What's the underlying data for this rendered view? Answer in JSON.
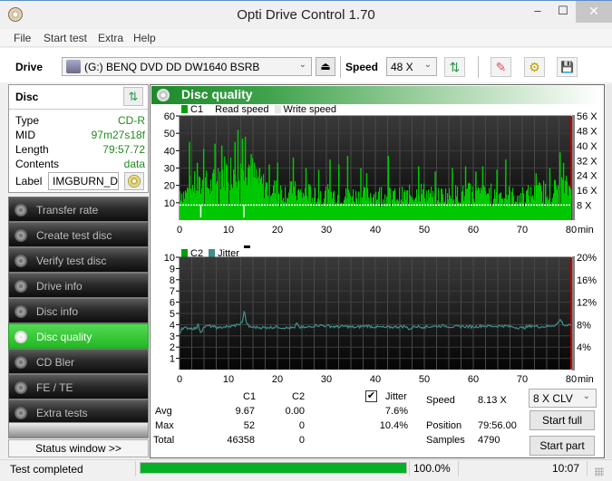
{
  "window": {
    "title": "Opti Drive Control 1.70",
    "min": "‒",
    "max": "☐",
    "close": "✕"
  },
  "menu": [
    "File",
    "Start test",
    "Extra",
    "Help"
  ],
  "toolbar": {
    "drive_label": "Drive",
    "drive_value": "(G:)  BENQ DVD DD DW1640 BSRB",
    "eject": "⏏",
    "speed_label": "Speed",
    "speed_value": "48 X",
    "dropdown_arrow": "⌄",
    "icons": [
      "refresh-icon",
      "eraser-icon",
      "settings-icon",
      "save-icon"
    ],
    "glyphs": {
      "refresh": "⇅",
      "eraser": "✎",
      "settings": "⚙",
      "save": "💾"
    }
  },
  "disc": {
    "title": "Disc",
    "refresh": "⇅",
    "rows": [
      {
        "key": "Type",
        "value": "CD-R"
      },
      {
        "key": "MID",
        "value": "97m27s18f"
      },
      {
        "key": "Length",
        "value": "79:57.72"
      },
      {
        "key": "Contents",
        "value": "data"
      }
    ],
    "label_key": "Label",
    "label_value": "IMGBURN_DIS"
  },
  "nav": [
    {
      "label": "Transfer rate",
      "active": false
    },
    {
      "label": "Create test disc",
      "active": false
    },
    {
      "label": "Verify test disc",
      "active": false
    },
    {
      "label": "Drive info",
      "active": false
    },
    {
      "label": "Disc info",
      "active": false
    },
    {
      "label": "Disc quality",
      "active": true
    },
    {
      "label": "CD Bler",
      "active": false
    },
    {
      "label": "FE / TE",
      "active": false
    },
    {
      "label": "Extra tests",
      "active": false
    }
  ],
  "status_window_button": "Status window >>",
  "panel": {
    "title": "Disc quality"
  },
  "colors": {
    "c1": "#00c800",
    "c2": "#007a00",
    "jitter": "#3f8f8a",
    "accent": "#22b922",
    "value_text": "#1f8a1f",
    "progress": "#06b025"
  },
  "chart_data": [
    {
      "type": "bar",
      "title": "C1",
      "legend": [
        "C1",
        "Read speed",
        "Write speed"
      ],
      "xlabel": "min",
      "xlim": [
        0,
        80
      ],
      "x_ticks": [
        0,
        10,
        20,
        30,
        40,
        50,
        60,
        70,
        80
      ],
      "ylim": [
        0,
        60
      ],
      "y_ticks": [
        10,
        20,
        30,
        40,
        50,
        60
      ],
      "y2_ticks": [
        "8 X",
        "16 X",
        "24 X",
        "32 X",
        "40 X",
        "48 X",
        "56 X"
      ],
      "y2lim": [
        0,
        56
      ],
      "read_speed_x": 8.1,
      "envelope": [
        [
          0,
          18
        ],
        [
          1,
          16
        ],
        [
          2,
          20
        ],
        [
          3,
          22
        ],
        [
          4,
          20
        ],
        [
          5,
          24
        ],
        [
          6,
          20
        ],
        [
          7,
          24
        ],
        [
          8,
          28
        ],
        [
          9,
          30
        ],
        [
          10,
          30
        ],
        [
          11,
          32
        ],
        [
          12,
          36
        ],
        [
          13,
          38
        ],
        [
          14,
          34
        ],
        [
          15,
          28
        ],
        [
          16,
          24
        ],
        [
          17,
          22
        ],
        [
          18,
          20
        ],
        [
          19,
          20
        ],
        [
          20,
          18
        ],
        [
          21,
          18
        ],
        [
          22,
          17
        ],
        [
          23,
          18
        ],
        [
          24,
          17
        ],
        [
          25,
          16
        ],
        [
          26,
          17
        ],
        [
          27,
          16
        ],
        [
          28,
          16
        ],
        [
          29,
          16
        ],
        [
          30,
          16
        ],
        [
          31,
          16
        ],
        [
          32,
          16
        ],
        [
          33,
          15
        ],
        [
          34,
          15
        ],
        [
          35,
          16
        ],
        [
          36,
          15
        ],
        [
          37,
          15
        ],
        [
          38,
          15
        ],
        [
          39,
          16
        ],
        [
          40,
          16
        ],
        [
          41,
          16
        ],
        [
          42,
          15
        ],
        [
          43,
          15
        ],
        [
          44,
          15
        ],
        [
          45,
          15
        ],
        [
          46,
          15
        ],
        [
          47,
          16
        ],
        [
          48,
          16
        ],
        [
          49,
          18
        ],
        [
          50,
          17
        ],
        [
          51,
          16
        ],
        [
          52,
          15
        ],
        [
          53,
          15
        ],
        [
          54,
          16
        ],
        [
          55,
          15
        ],
        [
          56,
          16
        ],
        [
          57,
          16
        ],
        [
          58,
          16
        ],
        [
          59,
          17
        ],
        [
          60,
          16
        ],
        [
          61,
          16
        ],
        [
          62,
          16
        ],
        [
          63,
          17
        ],
        [
          64,
          16
        ],
        [
          65,
          16
        ],
        [
          66,
          17
        ],
        [
          67,
          16
        ],
        [
          68,
          15
        ],
        [
          69,
          15
        ],
        [
          70,
          15
        ],
        [
          71,
          16
        ],
        [
          72,
          16
        ],
        [
          73,
          17
        ],
        [
          74,
          18
        ],
        [
          75,
          19
        ],
        [
          76,
          18
        ],
        [
          77,
          20
        ],
        [
          78,
          22
        ],
        [
          79,
          20
        ],
        [
          80,
          20
        ]
      ],
      "spikes": [
        [
          1.9,
          45
        ],
        [
          3.5,
          33
        ],
        [
          4.8,
          41
        ],
        [
          7.1,
          44
        ],
        [
          8.5,
          43
        ],
        [
          11.2,
          45
        ],
        [
          11.8,
          52
        ],
        [
          12.7,
          47
        ],
        [
          13.3,
          48
        ],
        [
          14.5,
          38
        ],
        [
          16.2,
          30
        ],
        [
          18.2,
          32
        ],
        [
          19.9,
          33
        ],
        [
          23.1,
          36
        ],
        [
          25.7,
          30
        ],
        [
          28.3,
          29
        ],
        [
          30.6,
          35
        ],
        [
          32.4,
          32
        ],
        [
          34.2,
          37
        ],
        [
          36.9,
          30
        ],
        [
          38.1,
          27
        ],
        [
          42.5,
          37
        ],
        [
          48.7,
          31
        ],
        [
          52.1,
          28
        ],
        [
          55.6,
          30
        ],
        [
          58.3,
          31
        ],
        [
          60.4,
          28
        ],
        [
          61.8,
          31
        ],
        [
          64.7,
          29
        ],
        [
          66.5,
          35
        ],
        [
          72.7,
          27
        ],
        [
          75.5,
          30
        ],
        [
          77.6,
          39
        ],
        [
          78.3,
          33
        ]
      ],
      "dips": [
        [
          4.2,
          2
        ],
        [
          13.0,
          2
        ]
      ]
    },
    {
      "type": "line",
      "title": "C2 / Jitter",
      "legend": [
        "C2",
        "Jitter"
      ],
      "xlabel": "min",
      "xlim": [
        0,
        80
      ],
      "x_ticks": [
        0,
        10,
        20,
        30,
        40,
        50,
        60,
        70,
        80
      ],
      "ylim": [
        0,
        10
      ],
      "y_ticks": [
        1,
        2,
        3,
        4,
        5,
        6,
        7,
        8,
        9,
        10
      ],
      "y2lim": [
        0,
        20
      ],
      "y2_ticks": [
        "4%",
        "8%",
        "12%",
        "16%",
        "20%"
      ],
      "c2_values": "all zero",
      "jitter_pct": [
        [
          0,
          6.4
        ],
        [
          0.5,
          7.4
        ],
        [
          2,
          7.4
        ],
        [
          3.5,
          7.3
        ],
        [
          3.8,
          8.2
        ],
        [
          4.3,
          6.6
        ],
        [
          5,
          7.6
        ],
        [
          6,
          7.8
        ],
        [
          7,
          7.6
        ],
        [
          8,
          7.4
        ],
        [
          9,
          7.6
        ],
        [
          10,
          7.6
        ],
        [
          11,
          7.8
        ],
        [
          12,
          8.0
        ],
        [
          12.8,
          8.4
        ],
        [
          13.2,
          10.4
        ],
        [
          13.6,
          8.6
        ],
        [
          14.2,
          7.6
        ],
        [
          16,
          7.5
        ],
        [
          18,
          7.5
        ],
        [
          20,
          7.6
        ],
        [
          22,
          7.4
        ],
        [
          23.5,
          7.4
        ],
        [
          24,
          8.3
        ],
        [
          24.5,
          7.5
        ],
        [
          26,
          7.5
        ],
        [
          28,
          7.9
        ],
        [
          30,
          7.8
        ],
        [
          32,
          7.6
        ],
        [
          34,
          7.7
        ],
        [
          36,
          7.5
        ],
        [
          38,
          7.8
        ],
        [
          40,
          7.6
        ],
        [
          42,
          7.5
        ],
        [
          44,
          7.6
        ],
        [
          46,
          7.7
        ],
        [
          47,
          7.2
        ],
        [
          48,
          7.7
        ],
        [
          50,
          7.6
        ],
        [
          52,
          7.7
        ],
        [
          54,
          7.8
        ],
        [
          56,
          7.6
        ],
        [
          58,
          7.7
        ],
        [
          60,
          7.6
        ],
        [
          62,
          7.8
        ],
        [
          64,
          7.7
        ],
        [
          66,
          7.8
        ],
        [
          68,
          7.6
        ],
        [
          70,
          7.4
        ],
        [
          72,
          7.8
        ],
        [
          74,
          7.6
        ],
        [
          76,
          7.8
        ],
        [
          77,
          8.0
        ],
        [
          77.8,
          8.9
        ],
        [
          78.5,
          7.9
        ],
        [
          80,
          7.8
        ]
      ]
    }
  ],
  "stats": {
    "col_c1": "C1",
    "col_c2": "C2",
    "col_jitter": "Jitter",
    "jitter_checked": "✔",
    "rows": [
      {
        "label": "Avg",
        "c1": "9.67",
        "c2": "0.00",
        "jitter": "7.6%"
      },
      {
        "label": "Max",
        "c1": "52",
        "c2": "0",
        "jitter": "10.4%"
      },
      {
        "label": "Total",
        "c1": "46358",
        "c2": "0",
        "jitter": ""
      }
    ],
    "speed_label": "Speed",
    "speed_value": "8.13 X",
    "position_label": "Position",
    "position_value": "79:56.00",
    "samples_label": "Samples",
    "samples_value": "4790",
    "test_speed": "8 X CLV",
    "start_full": "Start full",
    "start_part": "Start part"
  },
  "statusbar": {
    "text": "Test completed",
    "progress_pct": 100,
    "progress_text": "100.0%",
    "time": "10:07"
  }
}
